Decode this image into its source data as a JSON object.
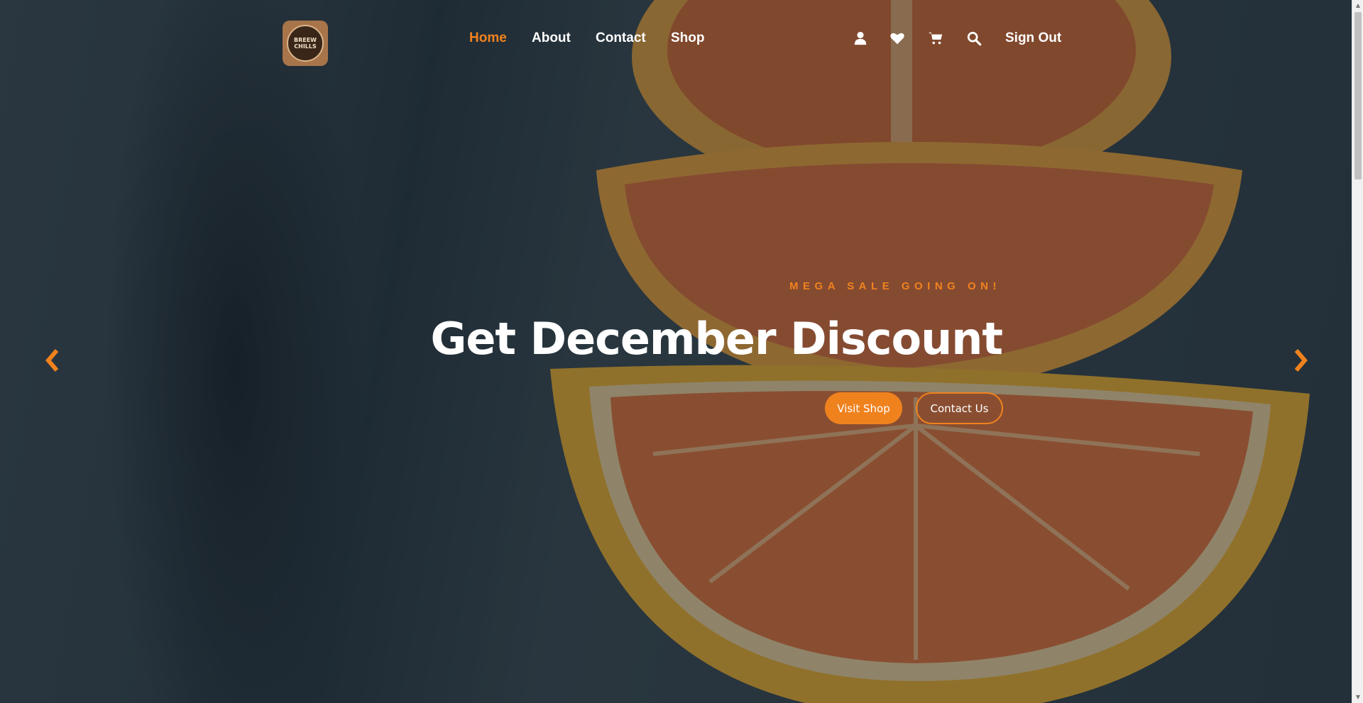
{
  "brand": {
    "logo_line1": "BREEW",
    "logo_line2": "CHILLS"
  },
  "nav": {
    "items": [
      {
        "label": "Home",
        "active": true
      },
      {
        "label": "About",
        "active": false
      },
      {
        "label": "Contact",
        "active": false
      },
      {
        "label": "Shop",
        "active": false
      }
    ],
    "icons": [
      "user-icon",
      "heart-icon",
      "cart-icon",
      "search-icon"
    ],
    "sign_out_label": "Sign Out"
  },
  "hero": {
    "eyebrow": "MEGA SALE GOING ON!",
    "headline": "Get December Discount",
    "primary_button": "Visit Shop",
    "secondary_button": "Contact Us"
  },
  "carousel": {
    "prev_icon": "chevron-left-icon",
    "next_icon": "chevron-right-icon"
  },
  "colors": {
    "accent": "#f0821e",
    "text": "#ffffff"
  }
}
